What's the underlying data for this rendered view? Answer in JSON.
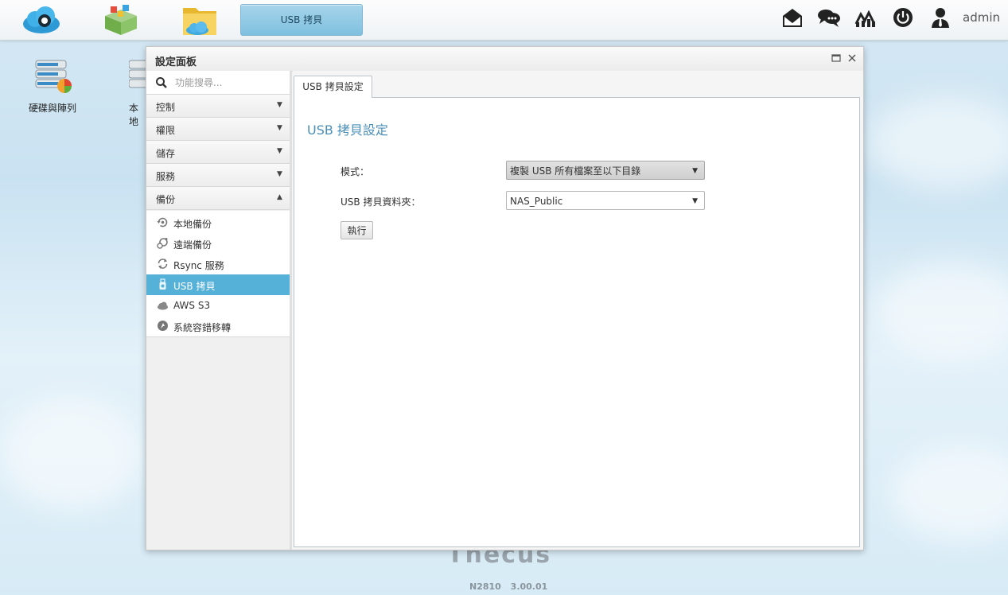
{
  "taskbar": {
    "apps": [
      "cloud-app-icon",
      "app-center-icon",
      "file-manager-icon"
    ],
    "active_task": "USB 拷貝",
    "user": "admin"
  },
  "desktop": {
    "icons": [
      {
        "label": "硬碟與陣列"
      },
      {
        "label": "本地"
      }
    ],
    "watermark": "Thecus",
    "footer": {
      "model": "N2810",
      "version": "3.00.01"
    }
  },
  "window": {
    "title": "設定面板",
    "search": {
      "placeholder": "功能搜尋...",
      "value": ""
    },
    "categories": [
      {
        "label": "控制",
        "state": "collapsed"
      },
      {
        "label": "權限",
        "state": "collapsed"
      },
      {
        "label": "儲存",
        "state": "collapsed"
      },
      {
        "label": "服務",
        "state": "collapsed"
      },
      {
        "label": "備份",
        "state": "expanded"
      }
    ],
    "backup_items": [
      {
        "label": "本地備份",
        "icon": "local-backup-icon"
      },
      {
        "label": "遠端備份",
        "icon": "remote-backup-icon"
      },
      {
        "label": "Rsync 服務",
        "icon": "rsync-icon"
      },
      {
        "label": "USB 拷貝",
        "icon": "usb-icon",
        "active": true
      },
      {
        "label": "AWS S3",
        "icon": "cloud-icon"
      },
      {
        "label": "系統容錯移轉",
        "icon": "failover-icon"
      }
    ],
    "tab": "USB 拷貝設定",
    "panel": {
      "title": "USB 拷貝設定",
      "mode_label": "模式：",
      "mode_value": "複製 USB 所有檔案至以下目錄",
      "folder_label": "USB 拷貝資料夾：",
      "folder_value": "NAS_Public",
      "run_label": "執行"
    }
  },
  "colors": {
    "accent": "#56b1d8",
    "title_blue": "#4a8fb8"
  }
}
